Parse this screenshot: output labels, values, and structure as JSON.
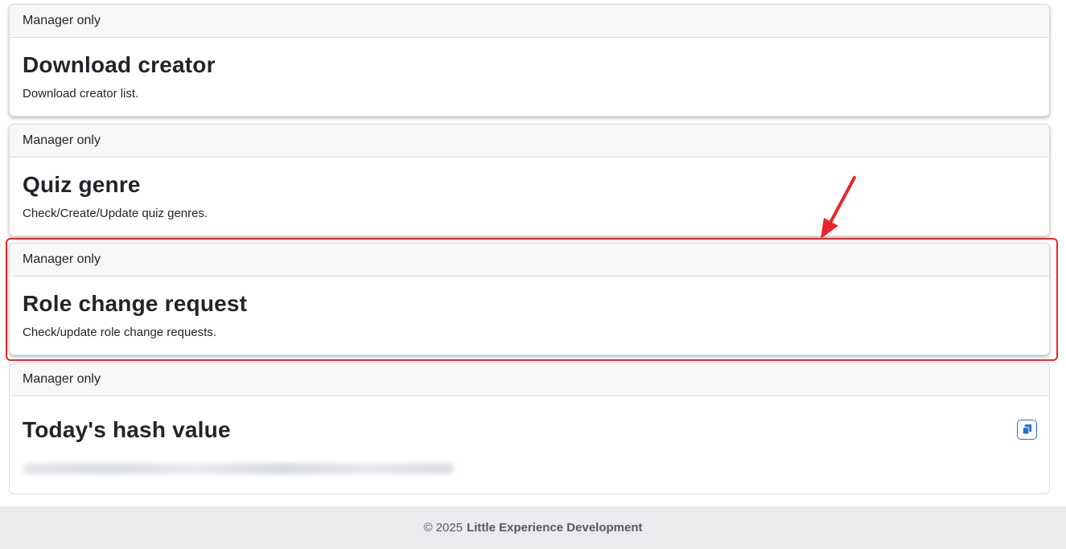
{
  "cards": [
    {
      "header": "Manager only",
      "title": "Download creator",
      "description": "Download creator list."
    },
    {
      "header": "Manager only",
      "title": "Quiz genre",
      "description": "Check/Create/Update quiz genres."
    },
    {
      "header": "Manager only",
      "title": "Role change request",
      "description": "Check/update role change requests."
    },
    {
      "header": "Manager only",
      "title": "Today's hash value",
      "copy_icon": "copy-icon"
    }
  ],
  "footer": {
    "copyright": "© 2025",
    "brand": "Little Experience Development"
  },
  "annotation": {
    "highlight_color": "#e8262b",
    "arrow_color": "#e8262b"
  },
  "colors": {
    "card_header_bg": "#f7f7f8",
    "footer_bg": "#ebebee",
    "copy_icon_color": "#2b6fd6"
  }
}
